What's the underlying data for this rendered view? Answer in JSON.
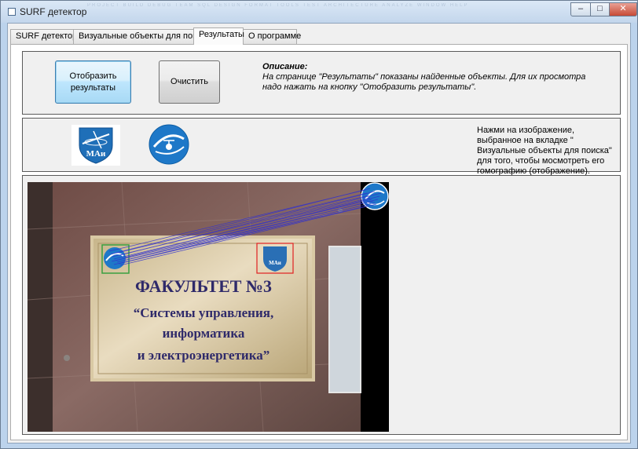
{
  "window": {
    "title": "SURF детектор",
    "menu_ghost": "PROJECT   BUILD   DEBUG   TEAM   SQL   DESIGN   FORMAT   TOOLS   TEST   ARCHITECTURE   ANALYZE   WINDOW   HELP",
    "controls": {
      "minimize": "–",
      "maximize": "□",
      "close": "✕"
    }
  },
  "tabs": [
    {
      "label": "SURF детектор"
    },
    {
      "label": "Визуальные объекты для поиска"
    },
    {
      "label": "Результаты"
    },
    {
      "label": "О программе"
    }
  ],
  "active_tab": "Результаты",
  "actions": {
    "show_line1": "Отобразить",
    "show_line2": "результаты",
    "clear": "Очистить"
  },
  "description": {
    "heading": "Описание:",
    "text": "На странице \"Результаты\" показаны найденные объекты. Для их просмотра надо нажать на кнопку \"Отобразить результаты\"."
  },
  "objects": {
    "hint": "Нажми на изображение, выбранное на вкладке \" Визуальные объекты для поиска\" для того, чтобы мосмотреть его гомографию (отображение).",
    "logo1_text": "МАи"
  },
  "result": {
    "plaque_line1": "ФАКУЛЬТЕТ №3",
    "plaque_line2": "“Системы управления,",
    "plaque_line3": "информатика",
    "plaque_line4": "и электроэнергетика”",
    "mark_text": "МАи",
    "match_color": "#3030d0",
    "detect_color": "#e02020"
  }
}
